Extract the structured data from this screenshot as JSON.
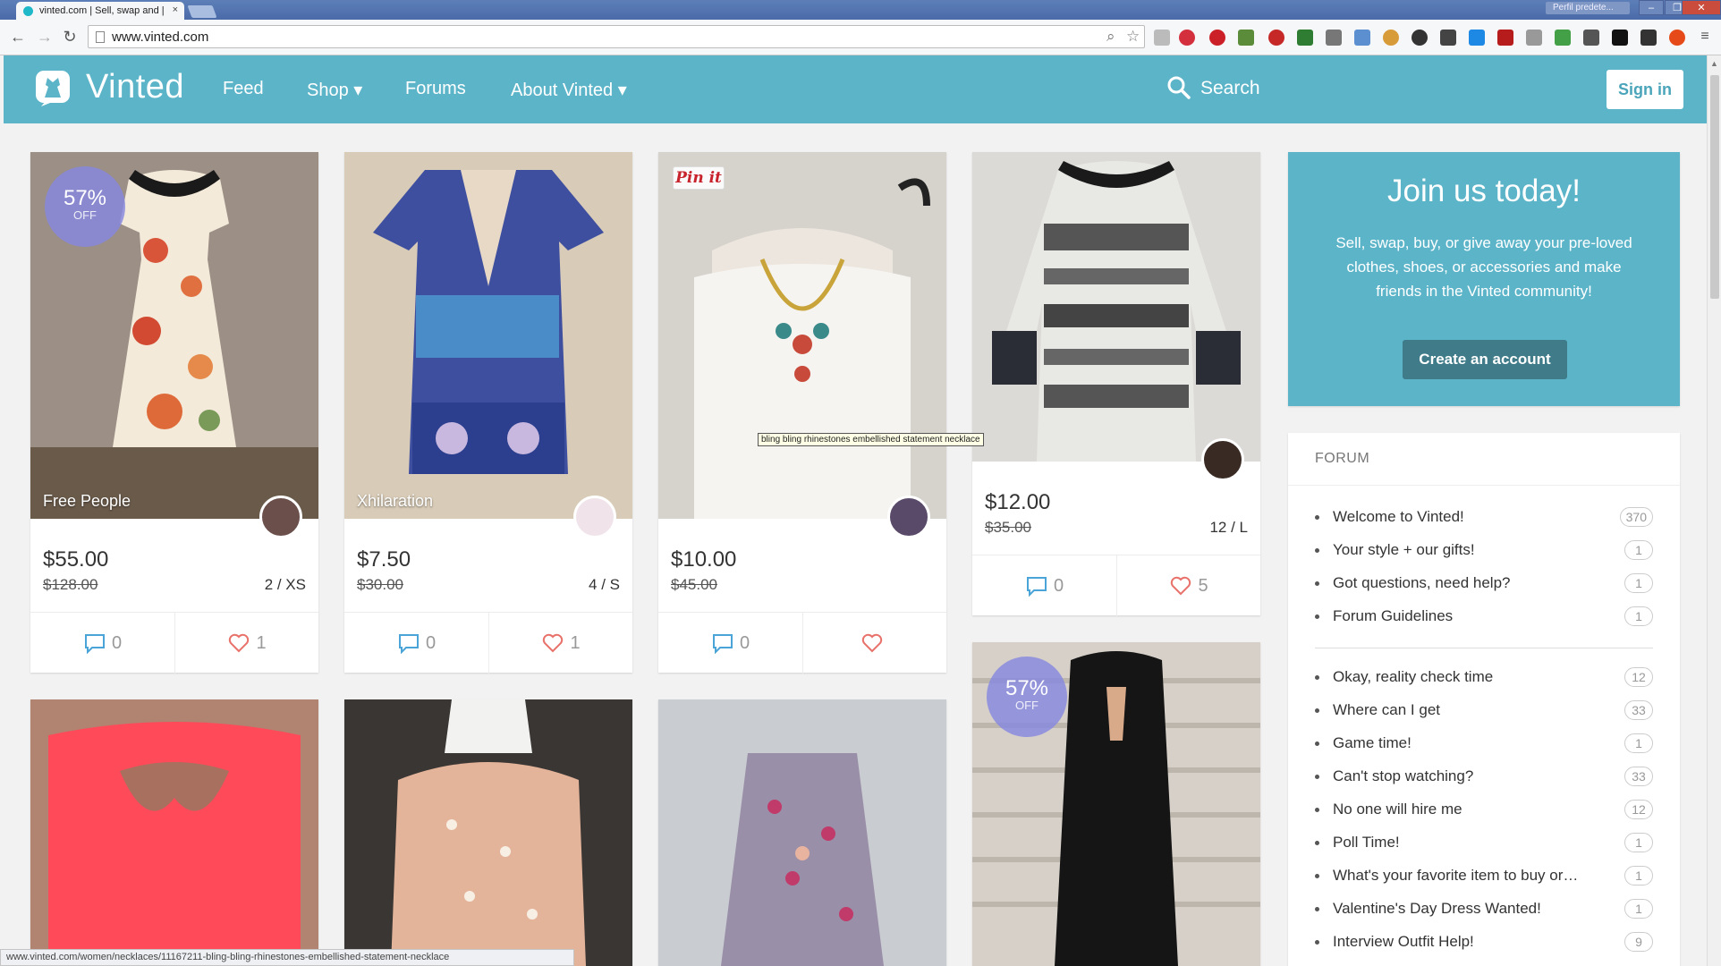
{
  "browser": {
    "tab_title": "vinted.com | Sell, swap and |",
    "tab_close": "×",
    "profile": "Perfil predete...",
    "window_buttons": [
      "–",
      "❐",
      "✕"
    ],
    "url": "www.vinted.com",
    "status_url": "www.vinted.com/women/necklaces/11167211-bling-bling-rhinestones-embellished-statement-necklace"
  },
  "header": {
    "logo": "Vinted",
    "nav": [
      {
        "label": "Feed"
      },
      {
        "label": "Shop ▾"
      },
      {
        "label": "Forums"
      },
      {
        "label": "About Vinted ▾"
      }
    ],
    "search": "Search",
    "sign_in": "Sign in"
  },
  "items": [
    {
      "brand": "Free People",
      "discount": "57%",
      "discount_sub": "OFF",
      "price": "$55.00",
      "old_price": "$128.00",
      "size": "2 / XS",
      "comments": "0",
      "likes": "1"
    },
    {
      "brand": "Xhilaration",
      "price": "$7.50",
      "old_price": "$30.00",
      "size": "4 / S",
      "comments": "0",
      "likes": "1"
    },
    {
      "brand": "",
      "pin": "Pin it",
      "price": "$10.00",
      "old_price": "$45.00",
      "size": "",
      "comments": "0",
      "likes": ""
    },
    {
      "brand": "",
      "price": "$12.00",
      "old_price": "$35.00",
      "size": "12 / L",
      "comments": "0",
      "likes": "5"
    },
    {
      "discount": "57%",
      "discount_sub": "OFF"
    }
  ],
  "tooltip": "bling bling rhinestones embellished statement necklace",
  "sidebar": {
    "join_title": "Join us today!",
    "join_text": "Sell, swap, buy, or give away your pre-loved clothes, shoes, or accessories and make friends in the Vinted community!",
    "join_button": "Create an account",
    "forum_title": "FORUM",
    "forum_pinned": [
      {
        "label": "Welcome to Vinted!",
        "count": "370"
      },
      {
        "label": "Your style + our gifts!",
        "count": "1"
      },
      {
        "label": "Got questions, need help?",
        "count": "1"
      },
      {
        "label": "Forum Guidelines",
        "count": "1"
      }
    ],
    "forum_topics": [
      {
        "label": "Okay, reality check time",
        "count": "12"
      },
      {
        "label": "Where can I get",
        "count": "33"
      },
      {
        "label": "Game time!",
        "count": "1"
      },
      {
        "label": "Can't stop watching?",
        "count": "33"
      },
      {
        "label": "No one will hire me",
        "count": "12"
      },
      {
        "label": "Poll Time!",
        "count": "1"
      },
      {
        "label": "What's your favorite item to buy or…",
        "count": "1"
      },
      {
        "label": "Valentine's Day Dress Wanted!",
        "count": "1"
      },
      {
        "label": "Interview Outfit Help!",
        "count": "9"
      }
    ]
  },
  "colors": {
    "brand_teal": "#5cb4c9",
    "cta_dark": "#3f7b89",
    "discount_badge": "#8688e0",
    "heart": "#e8726a",
    "comment": "#4aa4d8"
  }
}
